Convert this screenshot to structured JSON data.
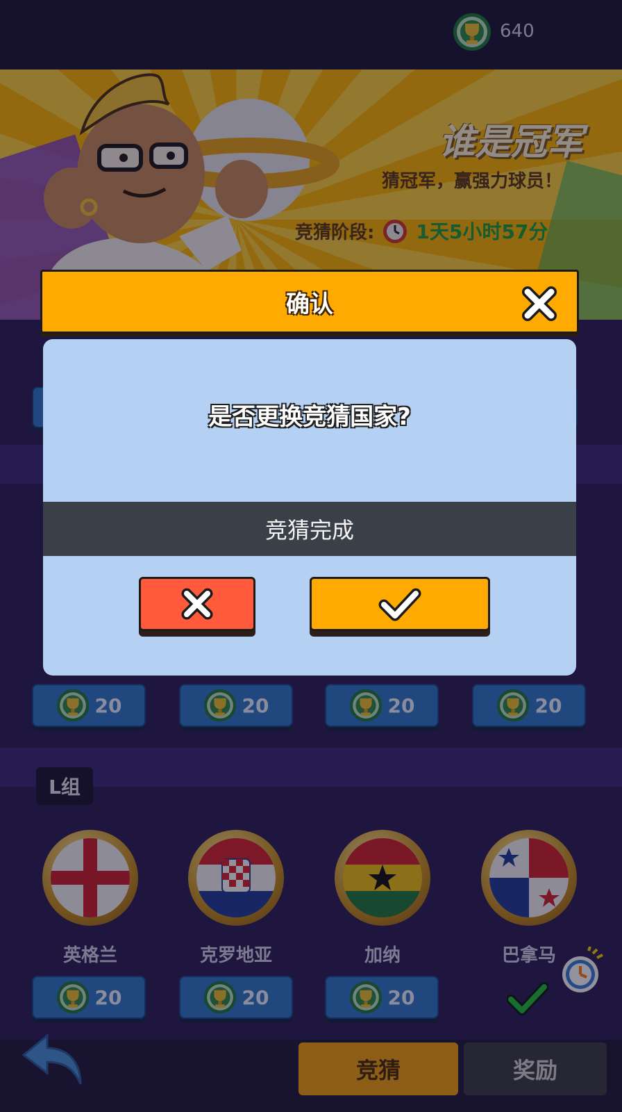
{
  "topbar": {
    "coin_balance": "640"
  },
  "banner": {
    "title": "谁是冠军",
    "subtitle": "猜冠军，赢强力球员！",
    "stage_label": "竞猜阶段:",
    "stage_time": "1天5小时57分"
  },
  "group": {
    "label": "L组",
    "middle_row_prices": [
      "20",
      "20",
      "20",
      "20"
    ],
    "teams": [
      {
        "name": "英格兰",
        "price": "20",
        "flag_icon": "england-flag-icon"
      },
      {
        "name": "克罗地亚",
        "price": "20",
        "flag_icon": "croatia-flag-icon"
      },
      {
        "name": "加纳",
        "price": "20",
        "flag_icon": "ghana-flag-icon"
      },
      {
        "name": "巴拿马",
        "selected": true,
        "flag_icon": "panama-flag-icon"
      }
    ]
  },
  "dialog": {
    "title": "确认",
    "question": "是否更换竞猜国家?",
    "status": "竞猜完成"
  },
  "bottom_nav": {
    "tab_guess": "竞猜",
    "tab_reward": "奖励"
  },
  "colors": {
    "accent_orange": "#ffaa00",
    "cancel_red": "#ff5a3c",
    "dialog_body": "#b4d0f2",
    "price_blue": "#2f79c8",
    "background": "#2a1f55"
  }
}
